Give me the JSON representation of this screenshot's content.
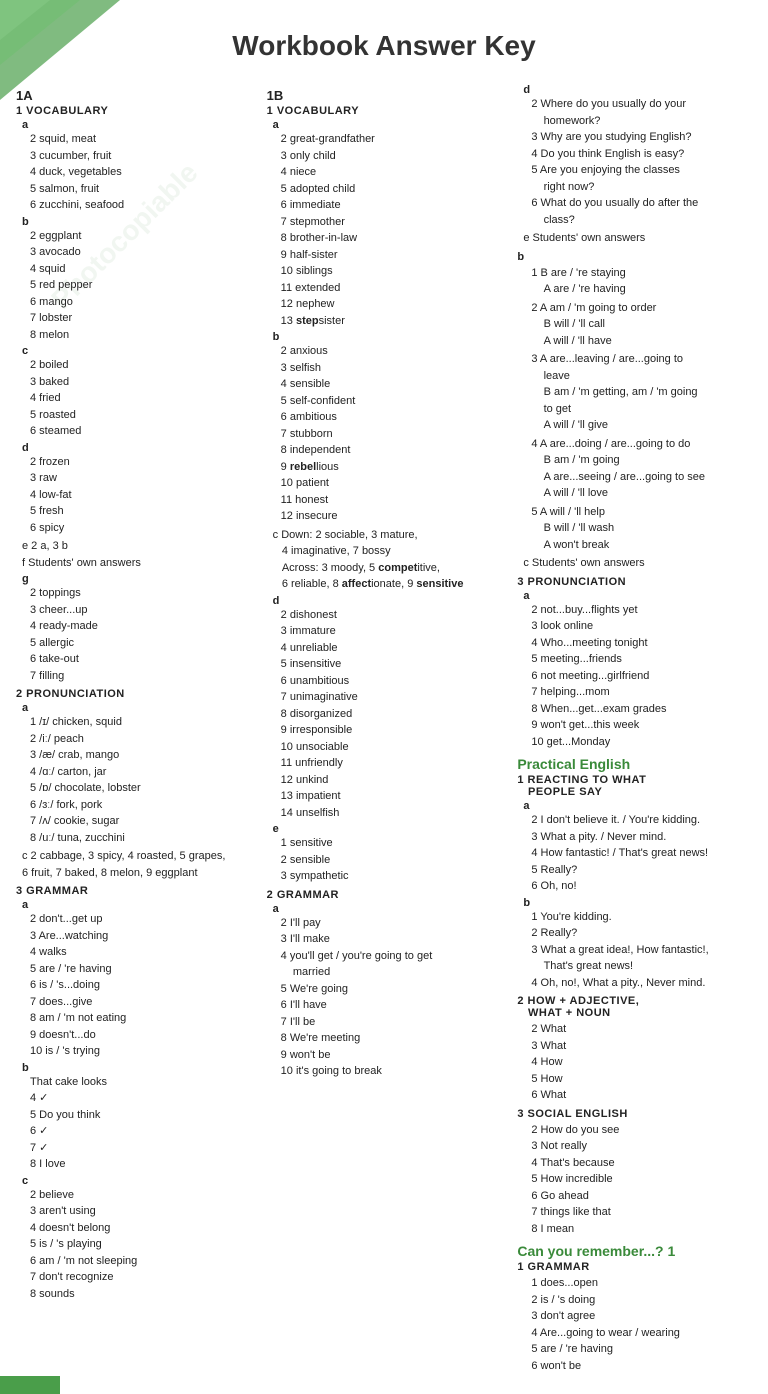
{
  "page": {
    "title": "Workbook Answer Key"
  },
  "col1": {
    "section1A": "1A",
    "vocab_header": "1  VOCABULARY",
    "vocab_a_label": "a",
    "vocab_a_items": [
      "2  squid, meat",
      "3  cucumber, fruit",
      "4  duck, vegetables",
      "5  salmon, fruit",
      "6  zucchini, seafood"
    ],
    "vocab_b_label": "b",
    "vocab_b_items": [
      "2  eggplant",
      "3  avocado",
      "4  squid",
      "5  red pepper",
      "6  mango",
      "7  lobster",
      "8  melon"
    ],
    "vocab_c_label": "c",
    "vocab_c_items": [
      "2  boiled",
      "3  baked",
      "4  fried",
      "5  roasted",
      "6  steamed"
    ],
    "vocab_d_label": "d",
    "vocab_d_items": [
      "2  frozen",
      "3  raw",
      "4  low-fat",
      "5  fresh",
      "6  spicy"
    ],
    "vocab_e": "e  2 a, 3 b",
    "vocab_f": "f  Students' own answers",
    "vocab_g_label": "g",
    "vocab_g_items": [
      "2  toppings",
      "3  cheer...up",
      "4  ready-made",
      "5  allergic",
      "6  take-out",
      "7  filling"
    ],
    "pronun_header": "2  PRONUNCIATION",
    "pronun_a_label": "a",
    "pronun_a_items": [
      "1  /ɪ/ chicken, squid",
      "2  /iː/ peach",
      "3  /æ/ crab, mango",
      "4  /ɑː/ carton, jar",
      "5  /ɒ/ chocolate, lobster",
      "6  /ɜː/ fork, pork",
      "7  /ʌ/ cookie, sugar",
      "8  /uː/ tuna, zucchini"
    ],
    "pronun_c": "c  2 cabbage, 3 spicy, 4 roasted, 5 grapes,\n6 fruit, 7 baked, 8 melon, 9 eggplant",
    "grammar_header": "3  GRAMMAR",
    "grammar_a_label": "a",
    "grammar_a_items": [
      "2  don't...get up",
      "3  Are...watching",
      "4  walks",
      "5  are / 're having",
      "6  is / 's...doing",
      "7  does...give",
      "8  am / 'm not eating",
      "9  doesn't...do",
      "10 is / 's trying"
    ],
    "grammar_b_label": "b",
    "grammar_b_items": [
      "That cake looks",
      "4  ✓",
      "5  Do you think",
      "6  ✓",
      "7  ✓",
      "8  I love"
    ],
    "grammar_c_label": "c",
    "grammar_c_items": [
      "2  believe",
      "3  aren't using",
      "4  doesn't belong",
      "5  is / 's playing",
      "6  am / 'm not sleeping",
      "7  don't recognize",
      "8  sounds"
    ]
  },
  "col2": {
    "section1B": "1B",
    "vocab_header": "1  VOCABULARY",
    "vocab_a_label": "a",
    "vocab_a_items": [
      "2  great-grandfather",
      "3  only child",
      "4  niece",
      "5  adopted child",
      "6  immediate",
      "7  stepmother",
      "8  brother-in-law",
      "9  half-sister",
      "10 siblings",
      "11 extended",
      "12 nephew",
      "13 stepsister"
    ],
    "vocab_b_label": "b",
    "vocab_b_items": [
      "2  anxious",
      "3  selfish",
      "4  sensible",
      "5  self-confident",
      "6  ambitious",
      "7  stubborn",
      "8  independent",
      "9  rebellious",
      "10 patient",
      "11 honest",
      "12 insecure"
    ],
    "vocab_c": "c  Down: 2 sociable, 3 mature,\n4 imaginative, 7 bossy\nAcross: 3 moody, 5 competitive,\n6 reliable, 8 affectionate, 9 sensitive",
    "vocab_d_label": "d",
    "vocab_d_items": [
      "2  dishonest",
      "3  immature",
      "4  unreliable",
      "5  insensitive",
      "6  unambitious",
      "7  unimaginative",
      "8  disorganized",
      "9  irresponsible",
      "10 unsociable",
      "11 unfriendly",
      "12 unkind",
      "13 impatient",
      "14 unselfish"
    ],
    "vocab_e_label": "e",
    "vocab_e_items": [
      "1  sensitive",
      "2  sensible",
      "3  sympathetic"
    ],
    "grammar_header": "2  GRAMMAR",
    "grammar_a_label": "a",
    "grammar_a_items": [
      "2  I'll pay",
      "3  I'll make",
      "4  you'll get / you're going to get\nmarried",
      "5  We're going",
      "6  I'll have",
      "7  I'll be",
      "8  We're meeting",
      "9  won't be",
      "10 it's going to break"
    ]
  },
  "col3": {
    "section_d_label": "d",
    "section_d_items": [
      "2  Where do you usually do your\nhomework?",
      "3  Why are you studying English?",
      "4  Do you think English is easy?",
      "5  Are you enjoying the classes\nright now?",
      "6  What do you usually do after the\nclass?"
    ],
    "section_e": "e  Students' own answers",
    "section_b_label": "b",
    "section_b_items": [
      "1  B are / 're staying\nA are / 're having",
      "2  A am / 'm going to order\nB will / 'll call\nA will / 'll have",
      "3  A are...leaving / are...going to\nleave\nB am / 'm getting, am / 'm going\nto get\nA will / 'll give",
      "4  A are...doing / are...going to do\nB am / 'm going\nA are...seeing / are...going to see\nA will / 'll love",
      "5  A will / 'll help\nB will / 'll wash\nA won't break"
    ],
    "section_c": "c  Students' own answers",
    "pronun_header": "3  PRONUNCIATION",
    "pronun_a_label": "a",
    "pronun_a_items": [
      "2  not...buy...flights yet",
      "3  look online",
      "4  Who...meeting tonight",
      "5  meeting...friends",
      "6  not meeting...girlfriend",
      "7  helping...mom",
      "8  When...get...exam grades",
      "9  won't get...this week",
      "10 get...Monday"
    ],
    "practical_header": "Practical English",
    "react_header": "1  REACTING TO WHAT\nPEOPLE SAY",
    "react_a_label": "a",
    "react_a_items": [
      "2  I don't believe it. / You're kidding.",
      "3  What a pity. / Never mind.",
      "4  How fantastic! / That's great news!",
      "5  Really?",
      "6  Oh, no!"
    ],
    "react_b_label": "b",
    "react_b_items": [
      "1  You're kidding.",
      "2  Really?",
      "3  What a great idea!, How fantastic!,\nThat's great news!",
      "4  Oh, no!, What a pity., Never mind."
    ],
    "how_header": "2  HOW + ADJECTIVE,\nWHAT + NOUN",
    "how_items": [
      "2  What",
      "3  What",
      "4  How",
      "5  How",
      "6  What"
    ],
    "social_header": "3  SOCIAL ENGLISH",
    "social_items": [
      "2  How do you see",
      "3  Not really",
      "4  That's because",
      "5  How incredible",
      "6  Go ahead",
      "7  things like that",
      "8  I mean"
    ],
    "can_remember": "Can you remember...? 1",
    "cr_grammar_header": "1  GRAMMAR",
    "cr_grammar_items": [
      "1  does...open",
      "2  is / 's doing",
      "3  don't agree",
      "4  Are...going to wear / wearing",
      "5  are / 're having",
      "6  won't be"
    ]
  }
}
